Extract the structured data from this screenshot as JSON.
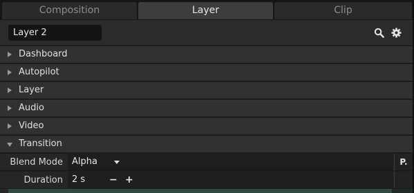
{
  "tabs": [
    {
      "label": "Composition",
      "active": false
    },
    {
      "label": "Layer",
      "active": true
    },
    {
      "label": "Clip",
      "active": false
    }
  ],
  "header": {
    "layer_name": "Layer 2",
    "search_icon": "search-icon",
    "settings_icon": "gear-icon"
  },
  "sections": [
    {
      "label": "Dashboard",
      "expanded": false
    },
    {
      "label": "Autopilot",
      "expanded": false
    },
    {
      "label": "Layer",
      "expanded": false
    },
    {
      "label": "Audio",
      "expanded": false
    },
    {
      "label": "Video",
      "expanded": false
    },
    {
      "label": "Transition",
      "expanded": true
    }
  ],
  "transition": {
    "blend_mode": {
      "label": "Blend Mode",
      "value": "Alpha",
      "param_button": "P."
    },
    "duration": {
      "label": "Duration",
      "value": "2 s",
      "decrement": "−",
      "increment": "+"
    }
  },
  "colors": {
    "background": "#1e1e1e",
    "section": "#313131",
    "active_tab": "#3d3d3d",
    "inactive_tab": "#2a2a2a",
    "accent_bottom": "#2f4a43"
  }
}
